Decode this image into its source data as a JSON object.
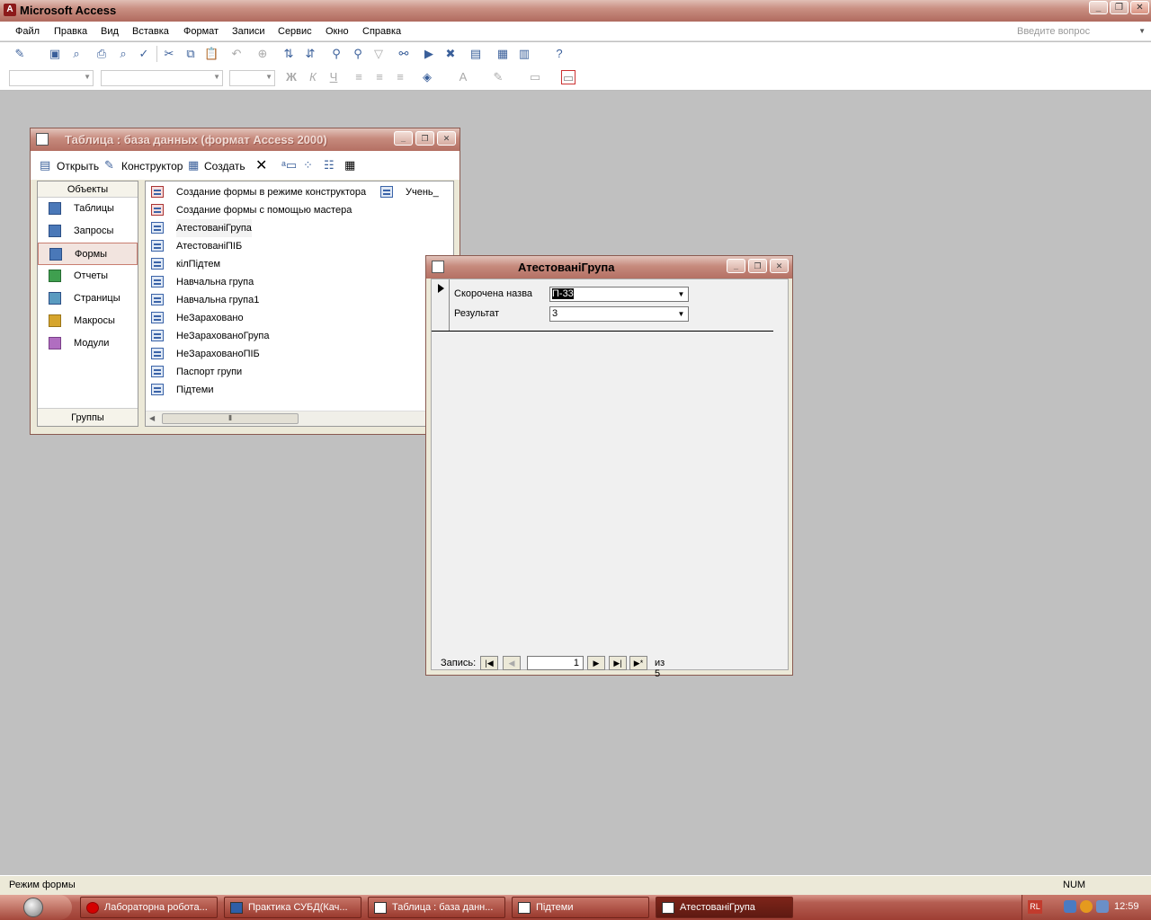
{
  "app": {
    "title": "Microsoft Access"
  },
  "menu": {
    "items": [
      "Файл",
      "Правка",
      "Вид",
      "Вставка",
      "Формат",
      "Записи",
      "Сервис",
      "Окно",
      "Справка"
    ],
    "ask_placeholder": "Введите вопрос"
  },
  "db_window": {
    "title": "Таблица : база данных (формат Access 2000)",
    "toolbar": {
      "open": "Открыть",
      "design": "Конструктор",
      "create": "Создать"
    },
    "objects_header": "Объекты",
    "objects": [
      "Таблицы",
      "Запросы",
      "Формы",
      "Отчеты",
      "Страницы",
      "Макросы",
      "Модули"
    ],
    "selected_object": "Формы",
    "groups": "Группы",
    "list": [
      "Создание формы в режиме конструктора",
      "Создание формы с помощью мастера",
      "АтестованіГрупа",
      "АтестованіПІБ",
      "кілПідтем",
      "Навчальна група",
      "Навчальна група1",
      "НеЗараховано",
      "НеЗарахованоГрупа",
      "НеЗарахованоПІБ",
      "Паспорт групи",
      "Підтеми"
    ],
    "list_col2": "Учень_"
  },
  "form_window": {
    "title": "АтестованіГрупа",
    "fields": [
      {
        "label": "Скорочена назва",
        "value": "П-33"
      },
      {
        "label": "Результат",
        "value": "3"
      }
    ],
    "nav": {
      "label": "Запись:",
      "current": "1",
      "of": "из",
      "total": "5"
    }
  },
  "status": {
    "mode": "Режим формы",
    "num": "NUM"
  },
  "taskbar": {
    "tasks": [
      {
        "label": "Лабораторна робота..."
      },
      {
        "label": "Практика СУБД(Кач..."
      },
      {
        "label": "Таблица : база данн..."
      },
      {
        "label": "Підтеми"
      },
      {
        "label": "АтестованіГрупа"
      }
    ],
    "lang": "RL",
    "clock": "12:59"
  }
}
